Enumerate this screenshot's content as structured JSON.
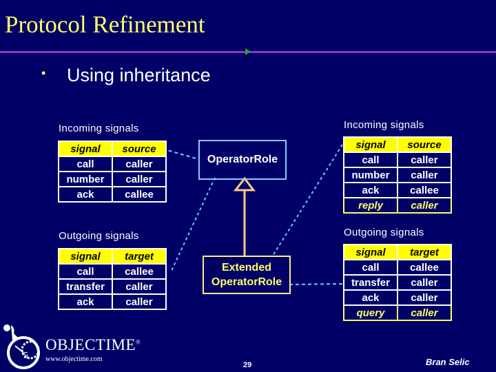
{
  "slide": {
    "title": "Protocol Refinement",
    "bullet": "•",
    "bullet_text": "Using inheritance",
    "page_number": "29",
    "author": "Bran Selic"
  },
  "logo": {
    "name": "OBJECTIME",
    "registered": "®",
    "url": "www.objectime.com"
  },
  "base": {
    "incoming": {
      "caption": "Incoming signals",
      "headers": [
        "signal",
        "source"
      ],
      "rows": [
        [
          "call",
          "caller"
        ],
        [
          "number",
          "caller"
        ],
        [
          "ack",
          "callee"
        ]
      ]
    },
    "outgoing": {
      "caption": "Outgoing signals",
      "headers": [
        "signal",
        "target"
      ],
      "rows": [
        [
          "call",
          "callee"
        ],
        [
          "transfer",
          "caller"
        ],
        [
          "ack",
          "caller"
        ]
      ]
    }
  },
  "extended": {
    "incoming": {
      "caption": "Incoming signals",
      "headers": [
        "signal",
        "source"
      ],
      "rows": [
        [
          "call",
          "caller"
        ],
        [
          "number",
          "caller"
        ],
        [
          "ack",
          "callee"
        ]
      ],
      "added_rows": [
        [
          "reply",
          "caller"
        ]
      ]
    },
    "outgoing": {
      "caption": "Outgoing signals",
      "headers": [
        "signal",
        "target"
      ],
      "rows": [
        [
          "call",
          "callee"
        ],
        [
          "transfer",
          "caller"
        ],
        [
          "ack",
          "caller"
        ]
      ],
      "added_rows": [
        [
          "query",
          "caller"
        ]
      ]
    }
  },
  "classes": {
    "base": "OperatorRole",
    "extended_line1": "Extended",
    "extended_line2": "OperatorRole"
  },
  "colors": {
    "background": "#000066",
    "title": "#ffff66",
    "rule": "#9933cc",
    "header_fill": "#ffff00",
    "base_class_border": "#88ccff",
    "extended_class_border": "#ffee88",
    "inheritance_arrow": "#ffcc88",
    "dashed_link": "#66ccff"
  }
}
